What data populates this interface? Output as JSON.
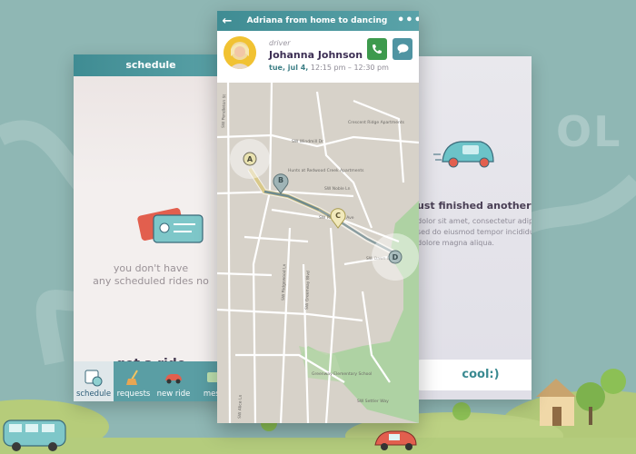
{
  "schedule_screen": {
    "title": "schedule",
    "empty_line1": "you don't have",
    "empty_line2": "any scheduled rides no",
    "cta": "get a ride",
    "tabs": [
      {
        "label": "schedule",
        "icon": "calendar-clock-icon",
        "active": true
      },
      {
        "label": "requests",
        "icon": "broom-icon",
        "active": false
      },
      {
        "label": "new ride",
        "icon": "car-icon",
        "active": false
      },
      {
        "label": "mess",
        "icon": "messages-icon",
        "active": false
      }
    ]
  },
  "ride_screen": {
    "title": "Adriana from home to dancing",
    "driver_role": "driver",
    "driver_name": "Johanna Johnson",
    "date": "tue, jul 4,",
    "time": "12:15 pm – 12:30 pm",
    "map": {
      "markers": [
        "A",
        "B",
        "C",
        "D"
      ],
      "street_labels": [
        "SW Pendleton St",
        "SW Ridgewood Ln",
        "Crescent Ridge Apartments",
        "SW Windmill Dr",
        "Hunts at Redwood Creek Apartments",
        "SW Noble Ln",
        "SW Dawn Dr",
        "SW Parkview Ave",
        "SW Greenway Blvd",
        "SW Alice Ln",
        "Greenway Elementary School",
        "SW Settler Way"
      ]
    }
  },
  "finished_screen": {
    "heading": "ust finished another ride!",
    "body": [
      "dolor sit amet, consectetur adipiscing",
      "sed do eiusmod tempor incididunt ut labore et",
      "dolore magna aliqua."
    ],
    "button": "cool:)"
  },
  "background_text": {
    "word": "OL"
  },
  "colors": {
    "accent": "#4b979d",
    "dark_text": "#3d2f54",
    "call": "#3d9a4d",
    "chat": "#4f94a2"
  }
}
